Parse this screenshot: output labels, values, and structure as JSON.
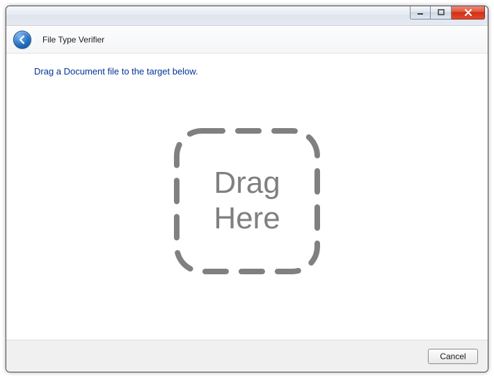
{
  "header": {
    "app_title": "File Type Verifier"
  },
  "content": {
    "instruction": "Drag a Document file to the target below.",
    "dropzone_line1": "Drag",
    "dropzone_line2": "Here"
  },
  "footer": {
    "cancel_label": "Cancel"
  }
}
